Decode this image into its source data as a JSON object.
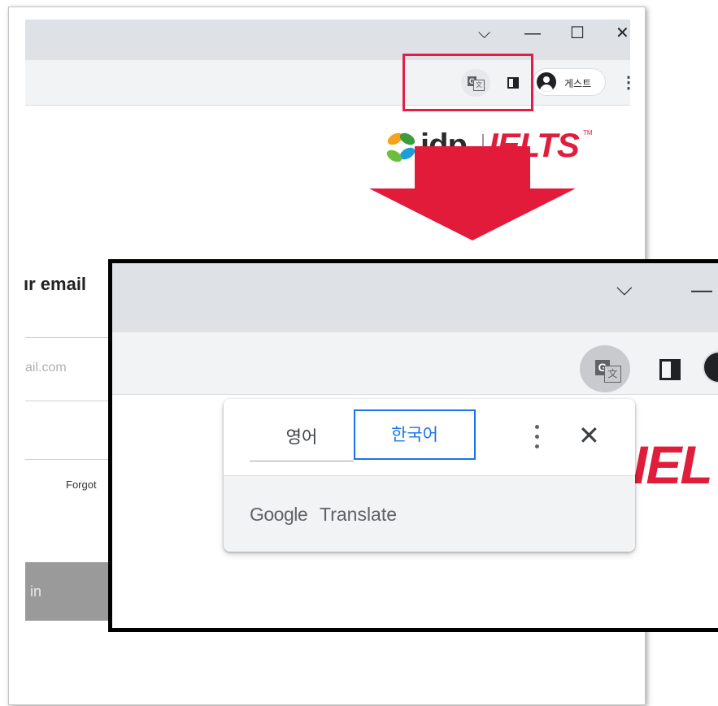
{
  "back": {
    "window_controls": {
      "chevron": "⌵",
      "minimize": "—",
      "maximize": "☐",
      "close": "✕"
    },
    "toolbar": {
      "translate_icon": "translate-icon",
      "guest_label": "게스트",
      "menu": "⋮"
    },
    "logo": {
      "idp": "idp",
      "ielts": "IELTS",
      "tm": "TM"
    },
    "page": {
      "heading": "ır email",
      "email_placeholder": "ail.com",
      "forgot": "Forgot",
      "login_label": "in"
    },
    "highlight_color": "#e11d48"
  },
  "inset": {
    "window_controls": {
      "chevron": "⌵",
      "minimize": "—"
    },
    "ielts_fragment": "IEL",
    "popup": {
      "source_language": "영어",
      "target_language": "한국어",
      "footer_google": "Google",
      "footer_translate": "Translate",
      "close": "✕"
    },
    "accent_color": "#1a73e8"
  }
}
